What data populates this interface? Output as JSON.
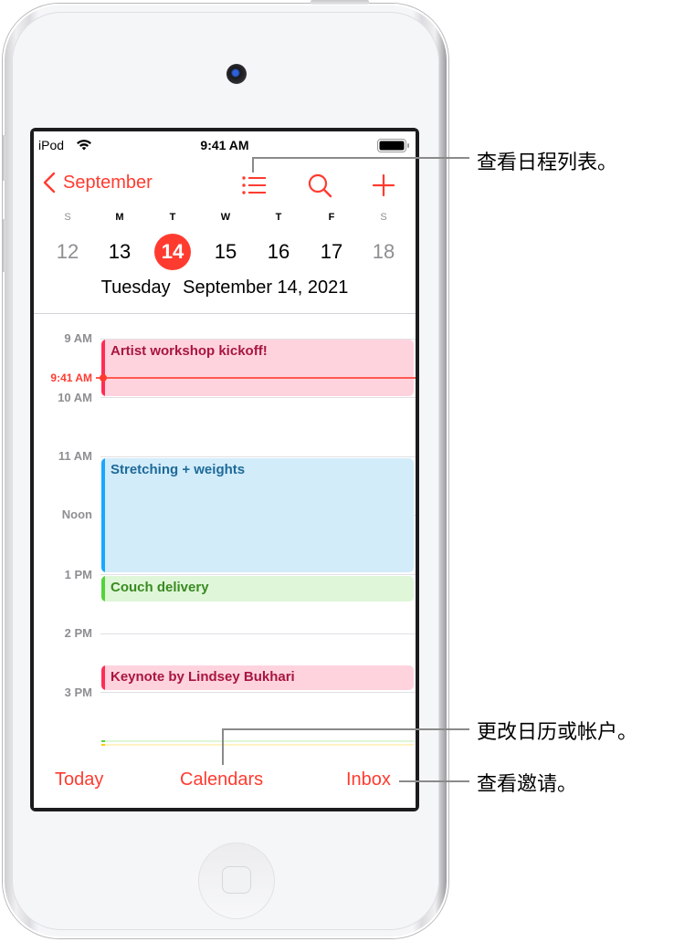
{
  "status_bar": {
    "carrier": "iPod",
    "wifi_icon": "wifi-icon",
    "time": "9:41 AM",
    "battery_icon": "battery-full-icon"
  },
  "nav_bar": {
    "back_label": "September",
    "back_icon": "chevron-left-icon",
    "list_icon": "list-icon",
    "search_icon": "search-icon",
    "add_icon": "plus-icon"
  },
  "week": {
    "weekdays": [
      "S",
      "M",
      "T",
      "W",
      "T",
      "F",
      "S"
    ],
    "dates": [
      "12",
      "13",
      "14",
      "15",
      "16",
      "17",
      "18"
    ],
    "selected_index": 2,
    "selected_day_name": "Tuesday",
    "selected_full_date": "September 14, 2021"
  },
  "timeline": {
    "hours": [
      "9 AM",
      "10 AM",
      "11 AM",
      "Noon",
      "1 PM",
      "2 PM",
      "3 PM"
    ],
    "now_label": "9:41 AM",
    "events": [
      {
        "title": "Artist workshop kickoff!",
        "start": "9:00",
        "end": "10:00",
        "color": "#ff2d55",
        "bg": "#ffd3de",
        "text_color": "#a8163f"
      },
      {
        "title": "Stretching + weights",
        "start": "11:00",
        "end": "13:00",
        "color": "#1aa8ff",
        "bg": "#d2ecfa",
        "text_color": "#1e6a98"
      },
      {
        "title": "Couch delivery",
        "start": "13:00",
        "end": "13:30",
        "color": "#52d33c",
        "bg": "#dff6d8",
        "text_color": "#3a8a22"
      },
      {
        "title": "Keynote by Lindsey Bukhari",
        "start": "14:35",
        "end": "15:00",
        "color": "#ff2d55",
        "bg": "#ffd3de",
        "text_color": "#a8163f"
      }
    ],
    "accent": "#ff3b30"
  },
  "toolbar": {
    "today_label": "Today",
    "calendars_label": "Calendars",
    "inbox_label": "Inbox"
  },
  "callouts": {
    "list_view": "查看日程列表。",
    "calendars": "更改日历或帐户。",
    "inbox": "查看邀请。"
  }
}
